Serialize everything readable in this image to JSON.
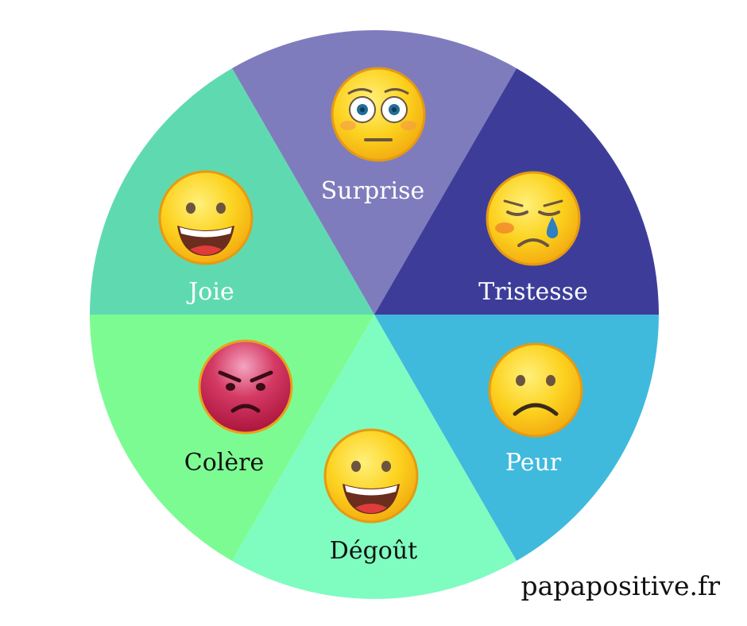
{
  "segments": [
    {
      "id": "surprise",
      "label": "Surprise",
      "color": "#7f7cbd",
      "text_color": "#ffffff",
      "face": "surprised",
      "face_color": "yellow"
    },
    {
      "id": "tristesse",
      "label": "Tristesse",
      "color": "#3d3d99",
      "text_color": "#ffffff",
      "face": "crying",
      "face_color": "yellow"
    },
    {
      "id": "peur",
      "label": "Peur",
      "color": "#3fbadd",
      "text_color": "#ffffff",
      "face": "frowning",
      "face_color": "yellow"
    },
    {
      "id": "degout",
      "label": "Dégoût",
      "color": "#7ffcc0",
      "text_color": "#111111",
      "face": "grinning",
      "face_color": "yellow"
    },
    {
      "id": "colere",
      "label": "Colère",
      "color": "#7dfb93",
      "text_color": "#111111",
      "face": "angry",
      "face_color": "red"
    },
    {
      "id": "joie",
      "label": "Joie",
      "color": "#5fdab0",
      "text_color": "#ffffff",
      "face": "grinning",
      "face_color": "yellow"
    }
  ],
  "site": "papapositive.fr"
}
